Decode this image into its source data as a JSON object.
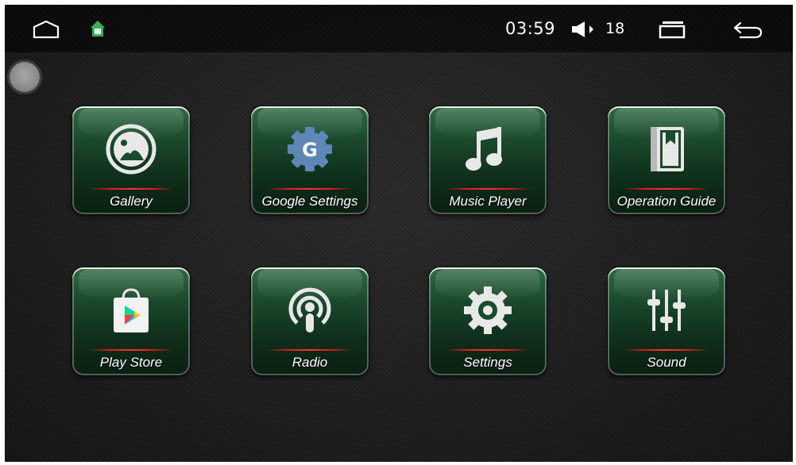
{
  "status_bar": {
    "time": "03:59",
    "volume": "18",
    "icons": [
      "home-icon",
      "android-notification-icon",
      "speaker-icon",
      "recent-apps-icon",
      "back-icon"
    ]
  },
  "apps": [
    {
      "label": "Gallery",
      "icon": "gallery-icon"
    },
    {
      "label": "Google Settings",
      "icon": "google-settings-icon"
    },
    {
      "label": "Music Player",
      "icon": "music-note-icon"
    },
    {
      "label": "Operation Guide",
      "icon": "book-icon"
    },
    {
      "label": "Play Store",
      "icon": "play-store-icon"
    },
    {
      "label": "Radio",
      "icon": "radio-icon"
    },
    {
      "label": "Settings",
      "icon": "gear-icon"
    },
    {
      "label": "Sound",
      "icon": "equalizer-icon"
    }
  ],
  "colors": {
    "tile_green": "#1b4a2d",
    "accent_red": "#e01818",
    "icon_white": "#e8e8e8",
    "google_blue": "#5f87b6"
  }
}
